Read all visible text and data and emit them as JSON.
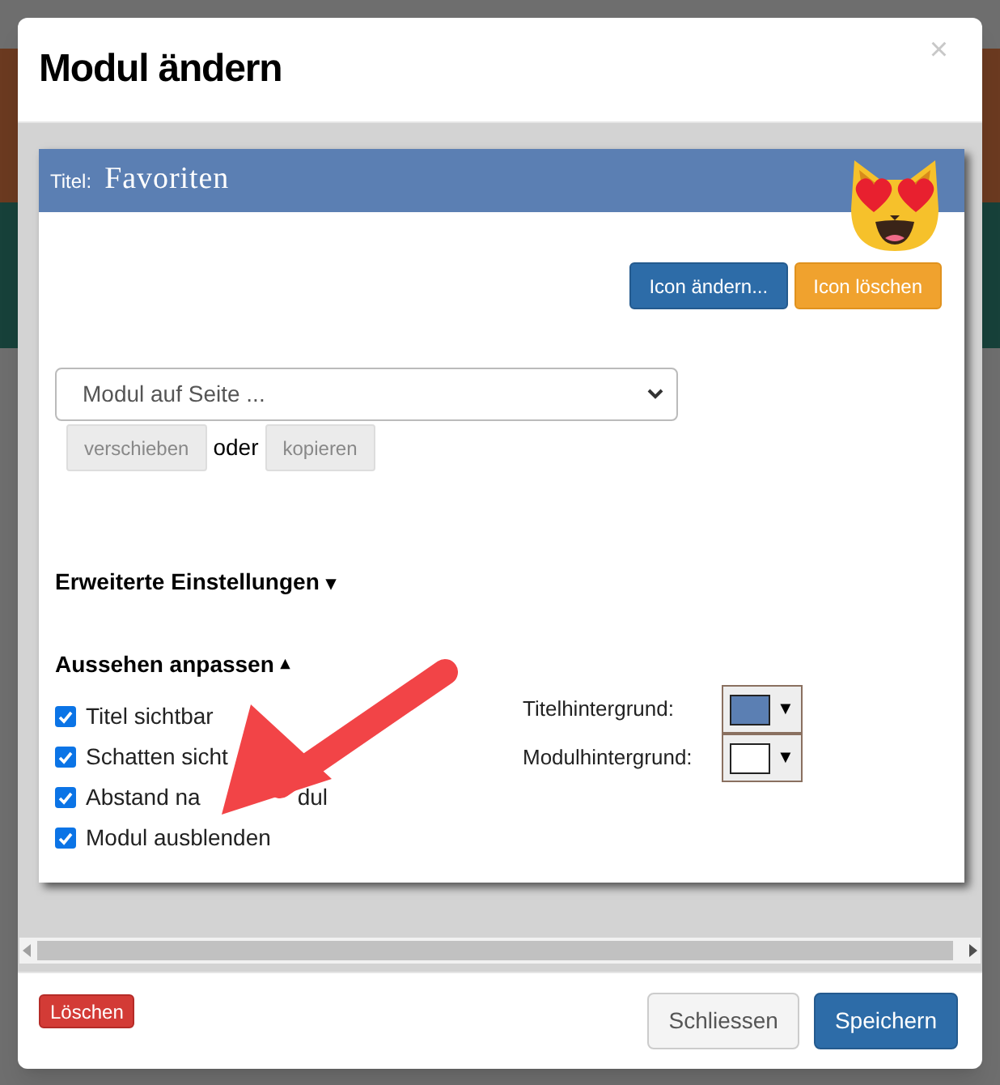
{
  "modal": {
    "title": "Modul ändern",
    "close": "×"
  },
  "module": {
    "title_label": "Titel:",
    "title": "Favoriten",
    "icon_buttons": [
      {
        "label": "Icon ändern...",
        "kind": "primary"
      },
      {
        "label": "Icon löschen",
        "kind": "warning"
      }
    ],
    "page_select": {
      "value": "Modul auf Seite ..."
    },
    "move_buttons": [
      {
        "label": "verschieben",
        "disabled": true
      },
      {
        "label": "kopieren",
        "disabled": true
      }
    ],
    "or_text": "oder",
    "sections": [
      {
        "label": "Erweiterte Einstellungen",
        "toggle": "▾",
        "expanded": false
      },
      {
        "label": "Aussehen anpassen",
        "toggle": "▴",
        "expanded": true
      }
    ],
    "options": [
      {
        "label": "Titel sichtbar",
        "checked": true
      },
      {
        "label": "Schatten sicht",
        "checked": true
      },
      {
        "label": "Abstand na",
        "label_tail": "dul",
        "checked": true
      },
      {
        "label": "Modul ausblenden",
        "checked": true
      }
    ],
    "colors": [
      {
        "label": "Titelhintergrund:",
        "color": "#5b7fb3",
        "caret": "▼"
      },
      {
        "label": "Modulhintergrund:",
        "color": "#ffffff",
        "caret": "▼"
      }
    ]
  },
  "footer": {
    "delete": "Löschen",
    "buttons": [
      {
        "label": "Schliessen",
        "kind": "default"
      },
      {
        "label": "Speichern",
        "kind": "primary"
      }
    ]
  }
}
